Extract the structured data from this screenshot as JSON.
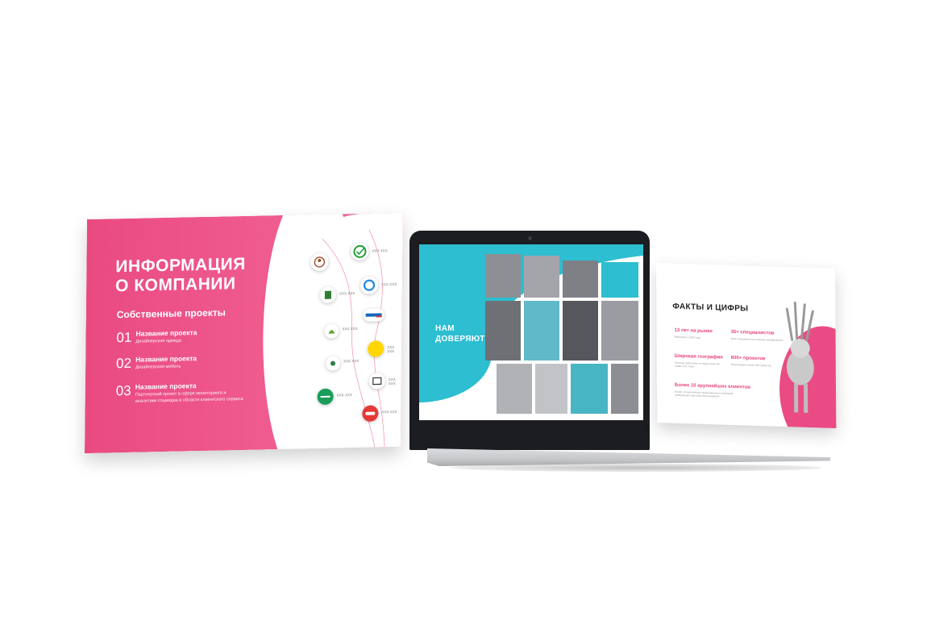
{
  "left_slide": {
    "title_line1": "ИНФОРМАЦИЯ",
    "title_line2": "О КОМПАНИИ",
    "subtitle": "Собственные проекты",
    "projects": [
      {
        "num": "01",
        "name": "Название проекта",
        "desc_line1": "Дизайнерская одежда",
        "desc_line2": ""
      },
      {
        "num": "02",
        "name": "Название проекта",
        "desc_line1": "Дизайнерская мебель",
        "desc_line2": ""
      },
      {
        "num": "03",
        "name": "Название проекта",
        "desc_line1": "Партнерский проект в сфере мониторинга и",
        "desc_line2": "аналитики соцмедиа в области клиентского сервиса"
      }
    ],
    "logo_placeholder": "XXX XXX",
    "colors": {
      "pink": "#e94a81"
    }
  },
  "laptop_screen": {
    "title_line1": "НАМ",
    "title_line2": "ДОВЕРЯЮТ",
    "colors": {
      "cyan": "#2dbed1"
    }
  },
  "right_slide": {
    "title": "ФАКТЫ И ЦИФРЫ",
    "facts": [
      {
        "heading": "13 лет на рынке",
        "sub": "Работаем с 2005 года"
      },
      {
        "heading": "35+ специалистов",
        "sub": "Штат специалистов в разных направлениях"
      },
      {
        "heading": "Широкая география",
        "sub": "Успешно работаем по территории РФ, стран СНГ, Азии"
      },
      {
        "heading": "600+ проектов",
        "sub": "Реализовано более 600 проектов"
      },
      {
        "heading": "Более 10 крупнейших клиентов",
        "sub": "Более 10 крупнейших международных компаний,"
      },
      {
        "heading": "",
        "sub": "доверяющих нам свое обслуживание"
      }
    ],
    "colors": {
      "pink": "#ea4b84"
    }
  }
}
